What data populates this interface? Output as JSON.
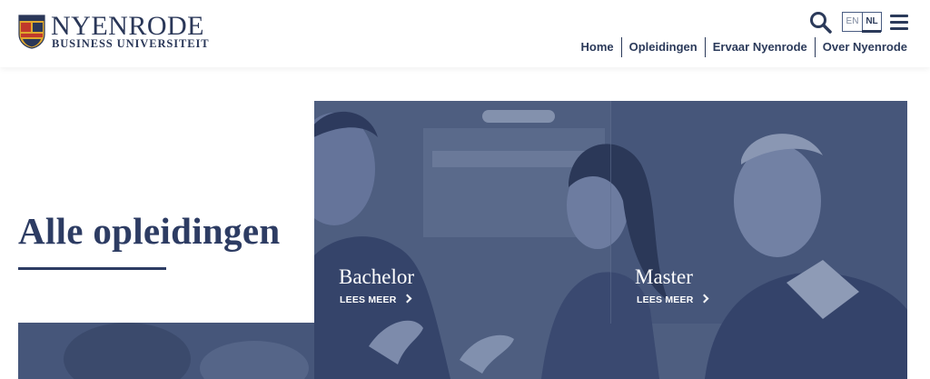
{
  "brand": {
    "name": "NYENRODE",
    "subtitle": "BUSINESS UNIVERSITEIT",
    "crest_colors": [
      "#c0392b",
      "#e0a82e",
      "#2a3758"
    ]
  },
  "header": {
    "languages": [
      {
        "code": "EN",
        "active": false
      },
      {
        "code": "NL",
        "active": true
      }
    ],
    "icons": [
      "search-icon",
      "menu-icon"
    ]
  },
  "nav": {
    "items": [
      {
        "label": "Home"
      },
      {
        "label": "Opleidingen"
      },
      {
        "label": "Ervaar Nyenrode"
      },
      {
        "label": "Over Nyenrode"
      }
    ]
  },
  "hero": {
    "title": "Alle opleidingen",
    "cards": [
      {
        "title": "Bachelor",
        "link": "LEES MEER"
      },
      {
        "title": "Master",
        "link": "LEES MEER"
      }
    ]
  },
  "colors": {
    "brand_navy": "#2b3a5a",
    "overlay": "#4a5a7d"
  }
}
